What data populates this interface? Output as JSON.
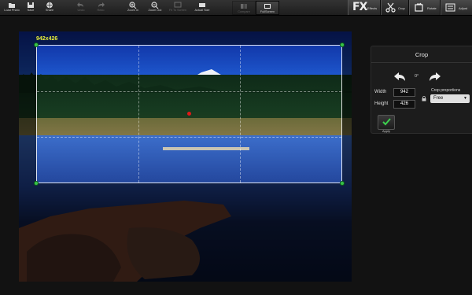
{
  "toolbar": {
    "left_tools": [
      {
        "name": "load-photo-button",
        "label": "Load Photo",
        "icon": "folder-icon",
        "enabled": true
      },
      {
        "name": "save-button",
        "label": "Save",
        "icon": "disk-icon",
        "enabled": true
      },
      {
        "name": "share-button",
        "label": "Share",
        "icon": "globe-icon",
        "enabled": true
      },
      {
        "name": "undo-button",
        "label": "Undo",
        "icon": "undo-icon",
        "enabled": false
      },
      {
        "name": "redo-button",
        "label": "Redo",
        "icon": "redo-icon",
        "enabled": false
      },
      {
        "name": "zoom-in-button",
        "label": "Zoom In",
        "icon": "zoom-in-icon",
        "enabled": true
      },
      {
        "name": "zoom-out-button",
        "label": "Zoom Out",
        "icon": "zoom-out-icon",
        "enabled": true
      },
      {
        "name": "fit-to-screen-button",
        "label": "Fit To Screen",
        "icon": "fit-screen-icon",
        "enabled": false
      },
      {
        "name": "actual-size-button",
        "label": "Actual Size",
        "icon": "actual-size-icon",
        "enabled": true
      },
      {
        "name": "compare-button",
        "label": "Compare",
        "icon": "compare-icon",
        "enabled": false
      },
      {
        "name": "fullscreen-button",
        "label": "FullScreen",
        "icon": "fullscreen-icon",
        "enabled": true
      }
    ],
    "fx": {
      "big": "FX",
      "small": "Effects"
    },
    "crop": {
      "label": "Crop",
      "icon": "scissors-icon"
    },
    "rotate": {
      "label": "Rotate",
      "icon": "rotate-icon"
    },
    "adjust": {
      "label": "Adjust",
      "icon": "adjust-icon"
    }
  },
  "canvas": {
    "crop_size_label": "942x426"
  },
  "crop_panel": {
    "title": "Crop",
    "rotation": "0°",
    "width_label": "Width",
    "width_value": "942",
    "height_label": "Height",
    "height_value": "426",
    "proportions_label": "Crop proportions",
    "proportions_value": "Free",
    "apply_label": "Apply",
    "colors": {
      "accent_check": "#3ccf4e",
      "handle": "#37c24a"
    }
  }
}
